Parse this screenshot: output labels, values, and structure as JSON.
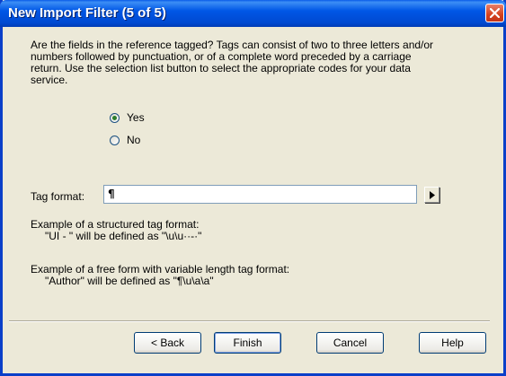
{
  "window": {
    "title": "New Import Filter (5 of 5)"
  },
  "description": "Are the fields in the reference tagged?  Tags can consist of two to three letters and/or numbers followed by punctuation, or of a complete word preceded by a carriage return.  Use the selection list button to select the appropriate codes for your data service.",
  "radio": {
    "yes_label": "Yes",
    "no_label": "No",
    "selected": "Yes"
  },
  "tag_format": {
    "label": "Tag format:",
    "value": "¶"
  },
  "examples": {
    "structured_heading": "Example of a structured tag format:",
    "structured_example": "\"UI  - \" will be defined as \"\\u\\u··-·\"",
    "freeform_heading": "Example of a free form with variable length tag format:",
    "freeform_example": "\"Author\" will be defined as \"¶\\u\\a\\a\""
  },
  "buttons": {
    "back": "< Back",
    "finish": "Finish",
    "cancel": "Cancel",
    "help": "Help"
  },
  "colors": {
    "titlebar": "#0054e3",
    "dialog_bg": "#ece9d8",
    "close_button": "#d5411d",
    "radio_dot": "#2c7d2c"
  }
}
